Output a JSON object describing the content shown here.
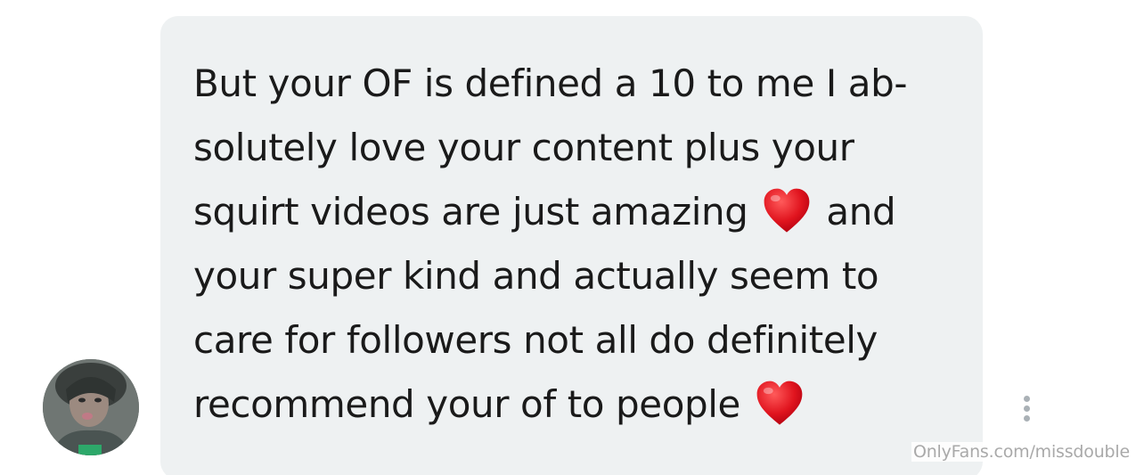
{
  "message": {
    "lines": [
      "But your OF is defined a 10 to me I ab-",
      "solutely love your content plus your",
      {
        "before": "squirt videos are just amazing",
        "after": "and"
      },
      "your super kind and actually seem to",
      "care for followers not all do definitely",
      {
        "before": "recommend your of to people",
        "after": ""
      }
    ],
    "emoji": "❤️"
  },
  "avatar": {
    "icon": "user-avatar-photo"
  },
  "menu": {
    "icon": "more-vertical-icon"
  },
  "watermark": "OnlyFans.com/missdouble",
  "colors": {
    "bubble": "#eef1f2",
    "text": "#1a1a1a",
    "heart": "#e0141e",
    "watermark": "#a9a9a9",
    "menu_dots": "#aab1b6"
  }
}
